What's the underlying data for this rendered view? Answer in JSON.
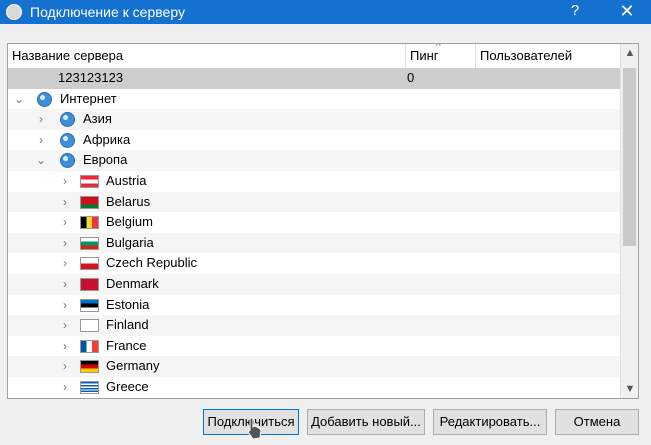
{
  "window": {
    "title": "Подключение к серверу",
    "help_label": "?",
    "close_label": "✕"
  },
  "columns": {
    "name": "Название сервера",
    "ping": "Пинг",
    "users": "Пользователей"
  },
  "rows": {
    "custom": {
      "name": "123123123",
      "ping": "0"
    },
    "internet": "Интернет",
    "asia": "Азия",
    "africa": "Африка",
    "europe": "Европа",
    "countries": [
      "Austria",
      "Belarus",
      "Belgium",
      "Bulgaria",
      "Czech Republic",
      "Denmark",
      "Estonia",
      "Finland",
      "France",
      "Germany",
      "Greece"
    ]
  },
  "buttons": {
    "connect": "Подключиться",
    "add": "Добавить новый...",
    "edit": "Редактировать...",
    "cancel": "Отмена"
  },
  "icons": {
    "expand": "chevron-right-icon",
    "collapse": "chevron-down-icon",
    "region": "globe-icon"
  }
}
